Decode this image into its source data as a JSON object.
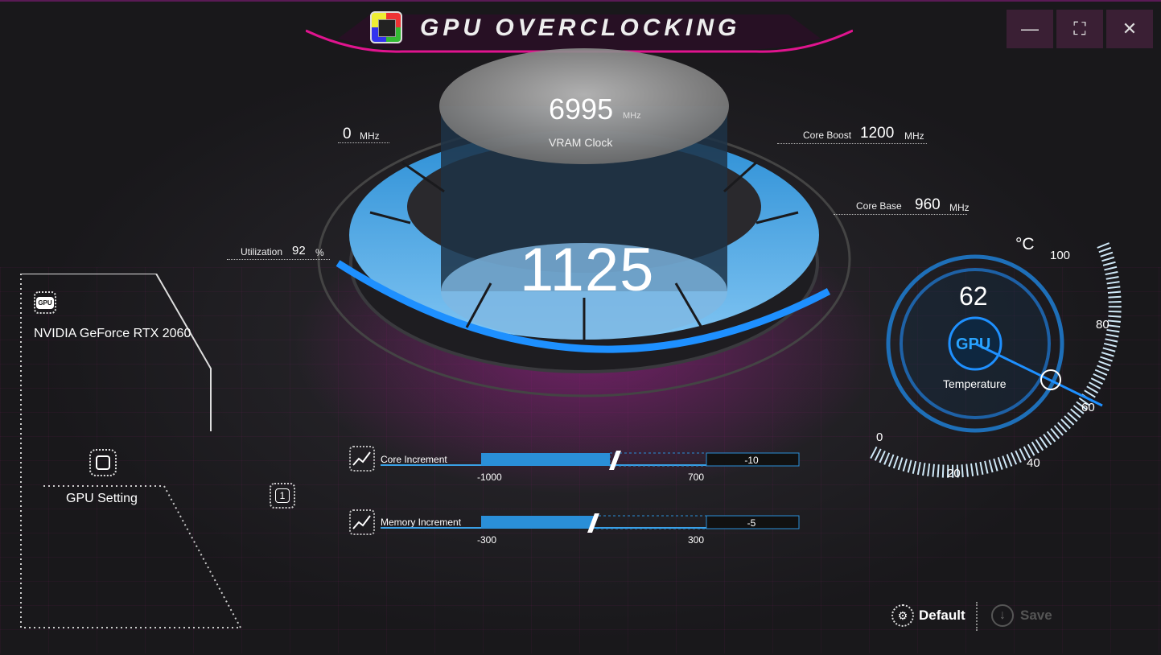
{
  "window": {
    "title": "GPU OVERCLOCKING",
    "minimize_icon": "minimize-icon",
    "maximize_icon": "maximize-icon",
    "close_icon": "close-icon",
    "accent_color": "#e0148f"
  },
  "vram": {
    "value": "6995",
    "unit": "MHz",
    "label": "VRAM Clock"
  },
  "core_clock": {
    "value": "1125"
  },
  "offset": {
    "value": "0",
    "unit": "MHz"
  },
  "core_boost": {
    "label": "Core Boost",
    "value": "1200",
    "unit": "MHz"
  },
  "core_base": {
    "label": "Core Base",
    "value": "960",
    "unit": "MHz"
  },
  "utilization": {
    "label": "Utilization",
    "value": "92",
    "unit": "%"
  },
  "gpu_card": {
    "name": "NVIDIA GeForce RTX 2060",
    "chip_text": "GPU"
  },
  "gpu_setting": {
    "label": "GPU Setting"
  },
  "profile": {
    "label": "1"
  },
  "sliders": {
    "core": {
      "title": "Core Increment",
      "min": "-1000",
      "max": "700",
      "value": "-10",
      "fraction": 0.59
    },
    "memory": {
      "title": "Memory Increment",
      "min": "-300",
      "max": "300",
      "value": "-5",
      "fraction": 0.49
    }
  },
  "temperature": {
    "unit": "°C",
    "value": "62",
    "gpu_text": "GPU",
    "label": "Temperature",
    "ticks": [
      "0",
      "20",
      "40",
      "60",
      "80",
      "100"
    ],
    "accent_color": "#1e90ff"
  },
  "footer": {
    "default_label": "Default",
    "save_label": "Save"
  }
}
